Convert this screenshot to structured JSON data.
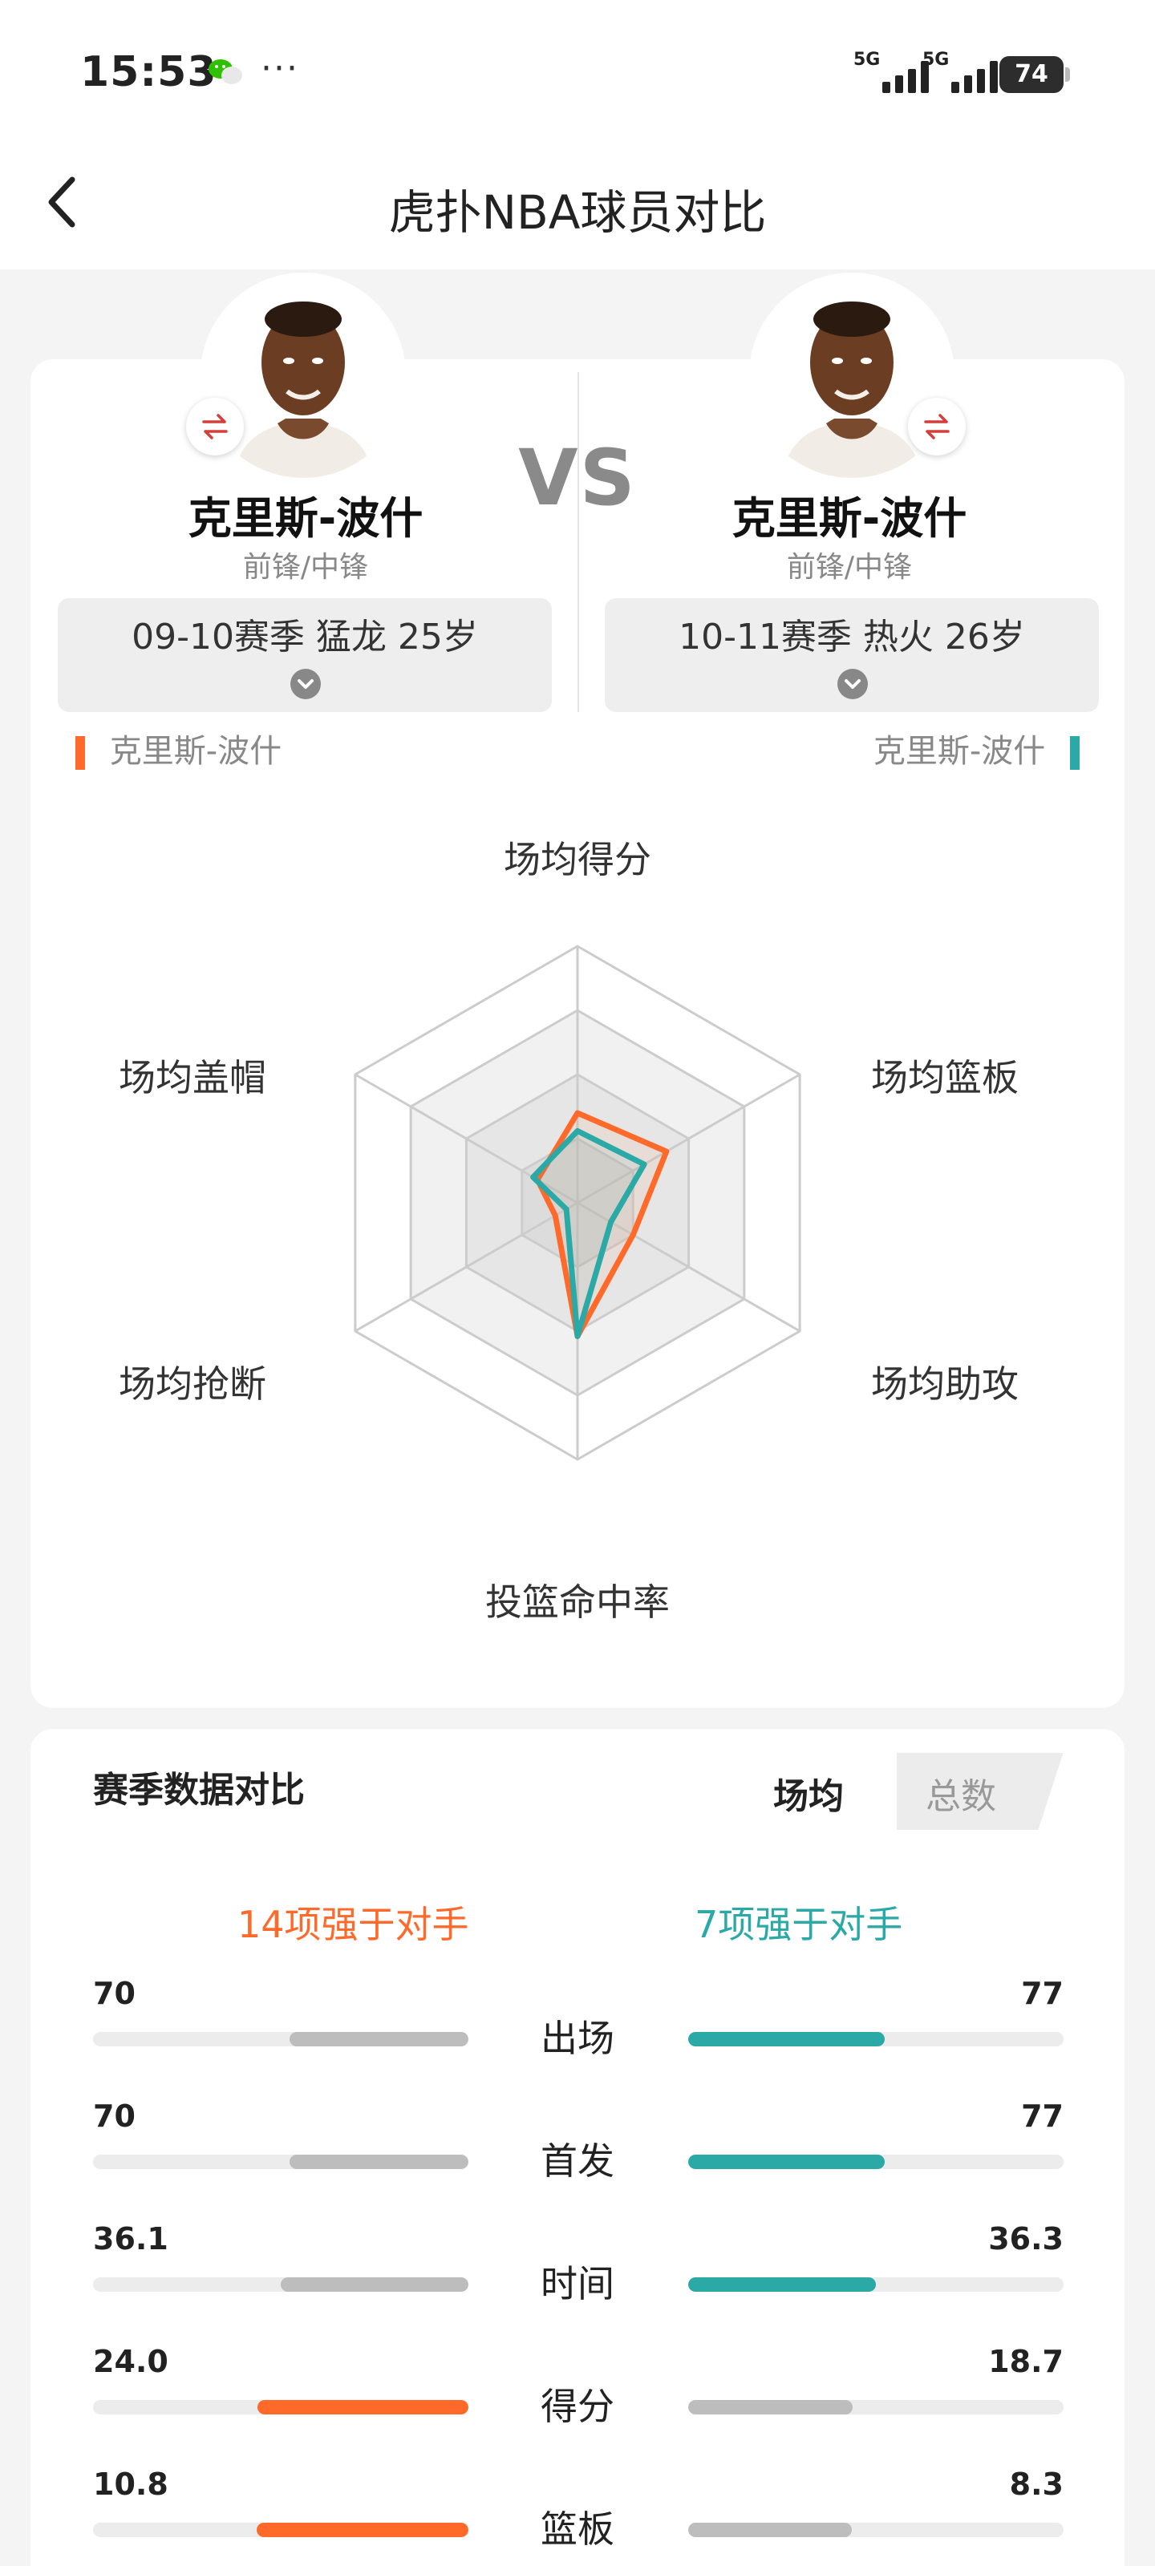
{
  "status_bar": {
    "time": "15:53",
    "dots": "···",
    "signal_1": "5G",
    "signal_2": "5G",
    "battery": "74"
  },
  "nav": {
    "title": "虎扑NBA球员对比",
    "back_icon": "chevron-left-icon"
  },
  "compare": {
    "vs": "VS",
    "left": {
      "name": "克里斯-波什",
      "position": "前锋/中锋",
      "season": "09-10赛季 猛龙 25岁",
      "legend": "克里斯-波什",
      "color": "#ff6a2b"
    },
    "right": {
      "name": "克里斯-波什",
      "position": "前锋/中锋",
      "season": "10-11赛季 热火 26岁",
      "legend": "克里斯-波什",
      "color": "#2aa9a6"
    }
  },
  "radar": {
    "axes": [
      "场均得分",
      "场均篮板",
      "场均助攻",
      "投篮命中率",
      "场均抢断",
      "场均盖帽"
    ],
    "left_values": [
      0.35,
      0.4,
      0.25,
      0.52,
      0.1,
      0.18
    ],
    "right_values": [
      0.28,
      0.3,
      0.15,
      0.52,
      0.05,
      0.2
    ]
  },
  "stats": {
    "title": "赛季数据对比",
    "tab_active": "场均",
    "tab_inactive": "总数",
    "left_summary": "14项强于对手",
    "right_summary": "7项强于对手",
    "rows": [
      {
        "label": "出场",
        "left": "70",
        "right": "77",
        "left_ratio": 0.476,
        "right_ratio": 0.524,
        "winner": "right"
      },
      {
        "label": "首发",
        "left": "70",
        "right": "77",
        "left_ratio": 0.476,
        "right_ratio": 0.524,
        "winner": "right"
      },
      {
        "label": "时间",
        "left": "36.1",
        "right": "36.3",
        "left_ratio": 0.499,
        "right_ratio": 0.501,
        "winner": "right"
      },
      {
        "label": "得分",
        "left": "24.0",
        "right": "18.7",
        "left_ratio": 0.562,
        "right_ratio": 0.438,
        "winner": "left"
      },
      {
        "label": "篮板",
        "left": "10.8",
        "right": "8.3",
        "left_ratio": 0.565,
        "right_ratio": 0.435,
        "winner": "left"
      }
    ]
  }
}
